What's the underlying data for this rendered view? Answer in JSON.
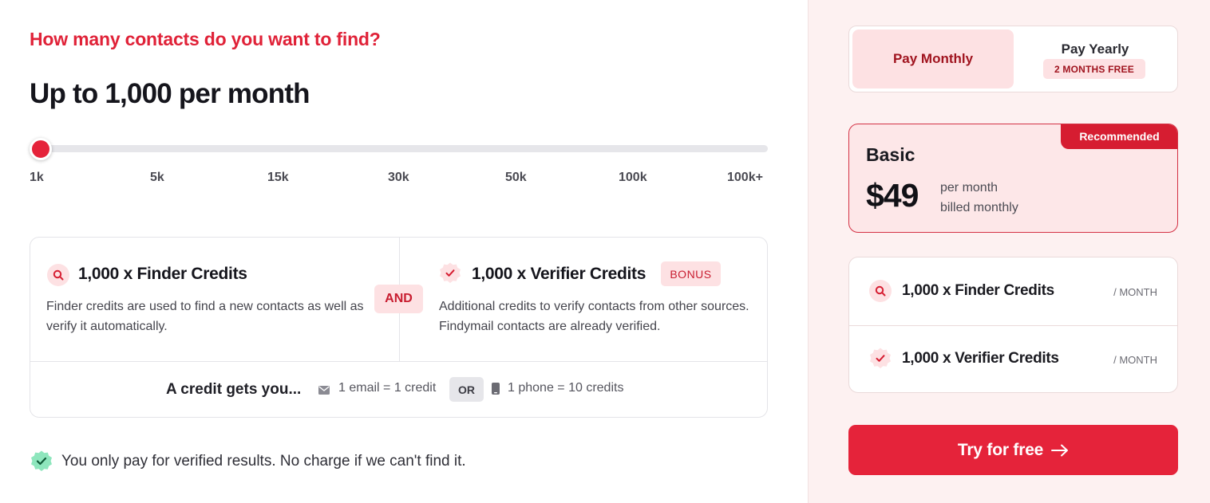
{
  "calculator": {
    "question": "How many contacts do you want to find?",
    "headline": "Up to 1,000 per month",
    "slider": {
      "value_label": "1k",
      "position_fraction": 0.0,
      "ticks": [
        "1k",
        "5k",
        "15k",
        "30k",
        "50k",
        "100k",
        "100k+"
      ]
    }
  },
  "credits": {
    "finder": {
      "icon": "search-icon",
      "title": "1,000 x Finder Credits",
      "description": "Finder credits are used to find a new contacts as well as verify it automatically."
    },
    "and_label": "AND",
    "verifier": {
      "icon": "verified-badge-icon",
      "title": "1,000 x Verifier Credits",
      "badge": "BONUS",
      "description": "Additional credits to verify contacts from other sources. Findymail contacts are already verified."
    },
    "credit_gets": {
      "label": "A credit gets you...",
      "email_icon": "envelope-icon",
      "email_text": "1 email = 1 credit",
      "or_label": "OR",
      "phone_icon": "phone-icon",
      "phone_text": "1 phone = 10 credits"
    }
  },
  "guarantee": {
    "icon": "check-badge-icon",
    "text": "You only pay for verified results. No charge if we can't find it."
  },
  "billing": {
    "monthly_label": "Pay Monthly",
    "yearly_label": "Pay Yearly",
    "yearly_badge": "2 MONTHS FREE",
    "selected": "monthly"
  },
  "plan": {
    "badge": "Recommended",
    "name": "Basic",
    "price": "$49",
    "period_line1": "per month",
    "period_line2": "billed monthly"
  },
  "features": [
    {
      "icon": "search-icon",
      "title": "1,000 x Finder Credits",
      "unit": "/ MONTH"
    },
    {
      "icon": "verified-badge-icon",
      "title": "1,000 x Verifier Credits",
      "unit": "/ MONTH"
    }
  ],
  "cta": {
    "label": "Try for free",
    "icon": "arrow-right-icon"
  },
  "colors": {
    "brand_red": "#e5233a",
    "light_pink": "#fde1e3",
    "panel_bg": "#fdf1f1",
    "success_green": "#38c98a"
  }
}
